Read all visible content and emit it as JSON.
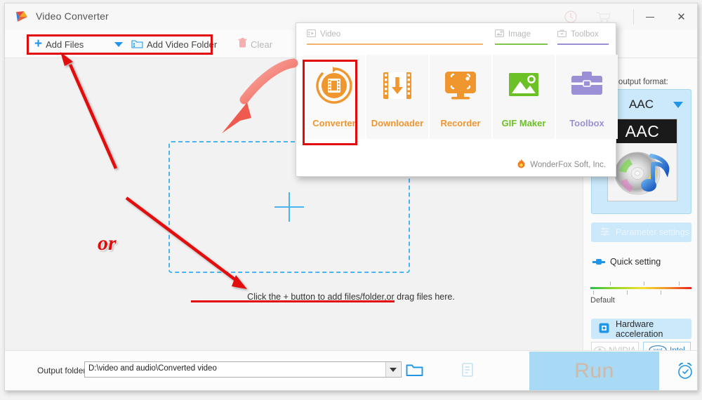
{
  "window": {
    "title": "Video Converter",
    "logo_icon": "play-triangle-logo",
    "controls": {
      "minimize": "minimize-icon",
      "close": "close-icon"
    },
    "titlebar_icons": [
      "help-clock-icon",
      "cart-icon"
    ]
  },
  "toolbar": {
    "add_files_label": "Add Files",
    "add_files_icon": "plus-icon",
    "add_files_caret_icon": "chevron-down-icon",
    "add_video_folder_label": "Add Video Folder",
    "add_video_folder_icon": "folder-video-icon",
    "clear_label": "Clear",
    "clear_icon": "trash-icon"
  },
  "main": {
    "dropzone_plus_icon": "plus-large-icon",
    "hint": "Click the + button to add files/folder,or drag files here.",
    "or_label": "or"
  },
  "sidebar": {
    "hint": "change output format:",
    "format_name": "AAC",
    "format_caret_icon": "chevron-down-icon",
    "format_thumb_label": "AAC",
    "format_thumb_icon": "cd-music-note-icon",
    "parameter_settings_label": "Parameter settings",
    "parameter_settings_icon": "sliders-icon",
    "quick_setting_label": "Quick setting",
    "quick_setting_icon": "slider-handle-icon",
    "slider_default_label": "Default",
    "hardware_acceleration_label": "Hardware acceleration",
    "hardware_acceleration_icon": "chip-icon",
    "gpu_buttons": [
      {
        "label": "NVIDIA",
        "icon": "nvidia-eye-icon",
        "active": false
      },
      {
        "label": "Intel",
        "icon": "intel-logo-icon",
        "active": true
      }
    ]
  },
  "bottom": {
    "output_folder_label": "Output folder:",
    "output_folder_value": "D:\\video and audio\\Converted video",
    "output_folder_caret_icon": "chevron-down-icon",
    "browse_icon": "open-folder-icon",
    "open_list_icon": "file-list-icon",
    "run_label": "Run",
    "alarm_icon": "alarm-clock-icon"
  },
  "mode_panel": {
    "tabs": [
      {
        "label": "Video",
        "icon": "video-frame-icon",
        "color": "#f6b26b"
      },
      {
        "label": "Image",
        "icon": "image-icon",
        "color": "#7ec64a"
      },
      {
        "label": "Toolbox",
        "icon": "toolbox-icon",
        "color": "#9a8fd4"
      }
    ],
    "items": [
      {
        "label": "Converter",
        "icon": "converter-film-circle-icon",
        "color": "#f0962f",
        "selected": true
      },
      {
        "label": "Downloader",
        "icon": "film-download-icon",
        "color": "#f0962f",
        "selected": false
      },
      {
        "label": "Recorder",
        "icon": "monitor-record-icon",
        "color": "#f0962f",
        "selected": false
      },
      {
        "label": "GIF Maker",
        "icon": "photo-mountain-icon",
        "color": "#6cc126",
        "selected": false
      },
      {
        "label": "Toolbox",
        "icon": "toolbox-case-icon",
        "color": "#9b8fd6",
        "selected": false
      }
    ],
    "brand": "WonderFox Soft, Inc.",
    "brand_icon": "wonderfox-flame-icon"
  },
  "colors": {
    "highlight_red": "#e20b0b",
    "accent_blue": "#2196e8",
    "orange": "#f0962f",
    "green": "#6cc126",
    "purple": "#9b8fd6"
  }
}
